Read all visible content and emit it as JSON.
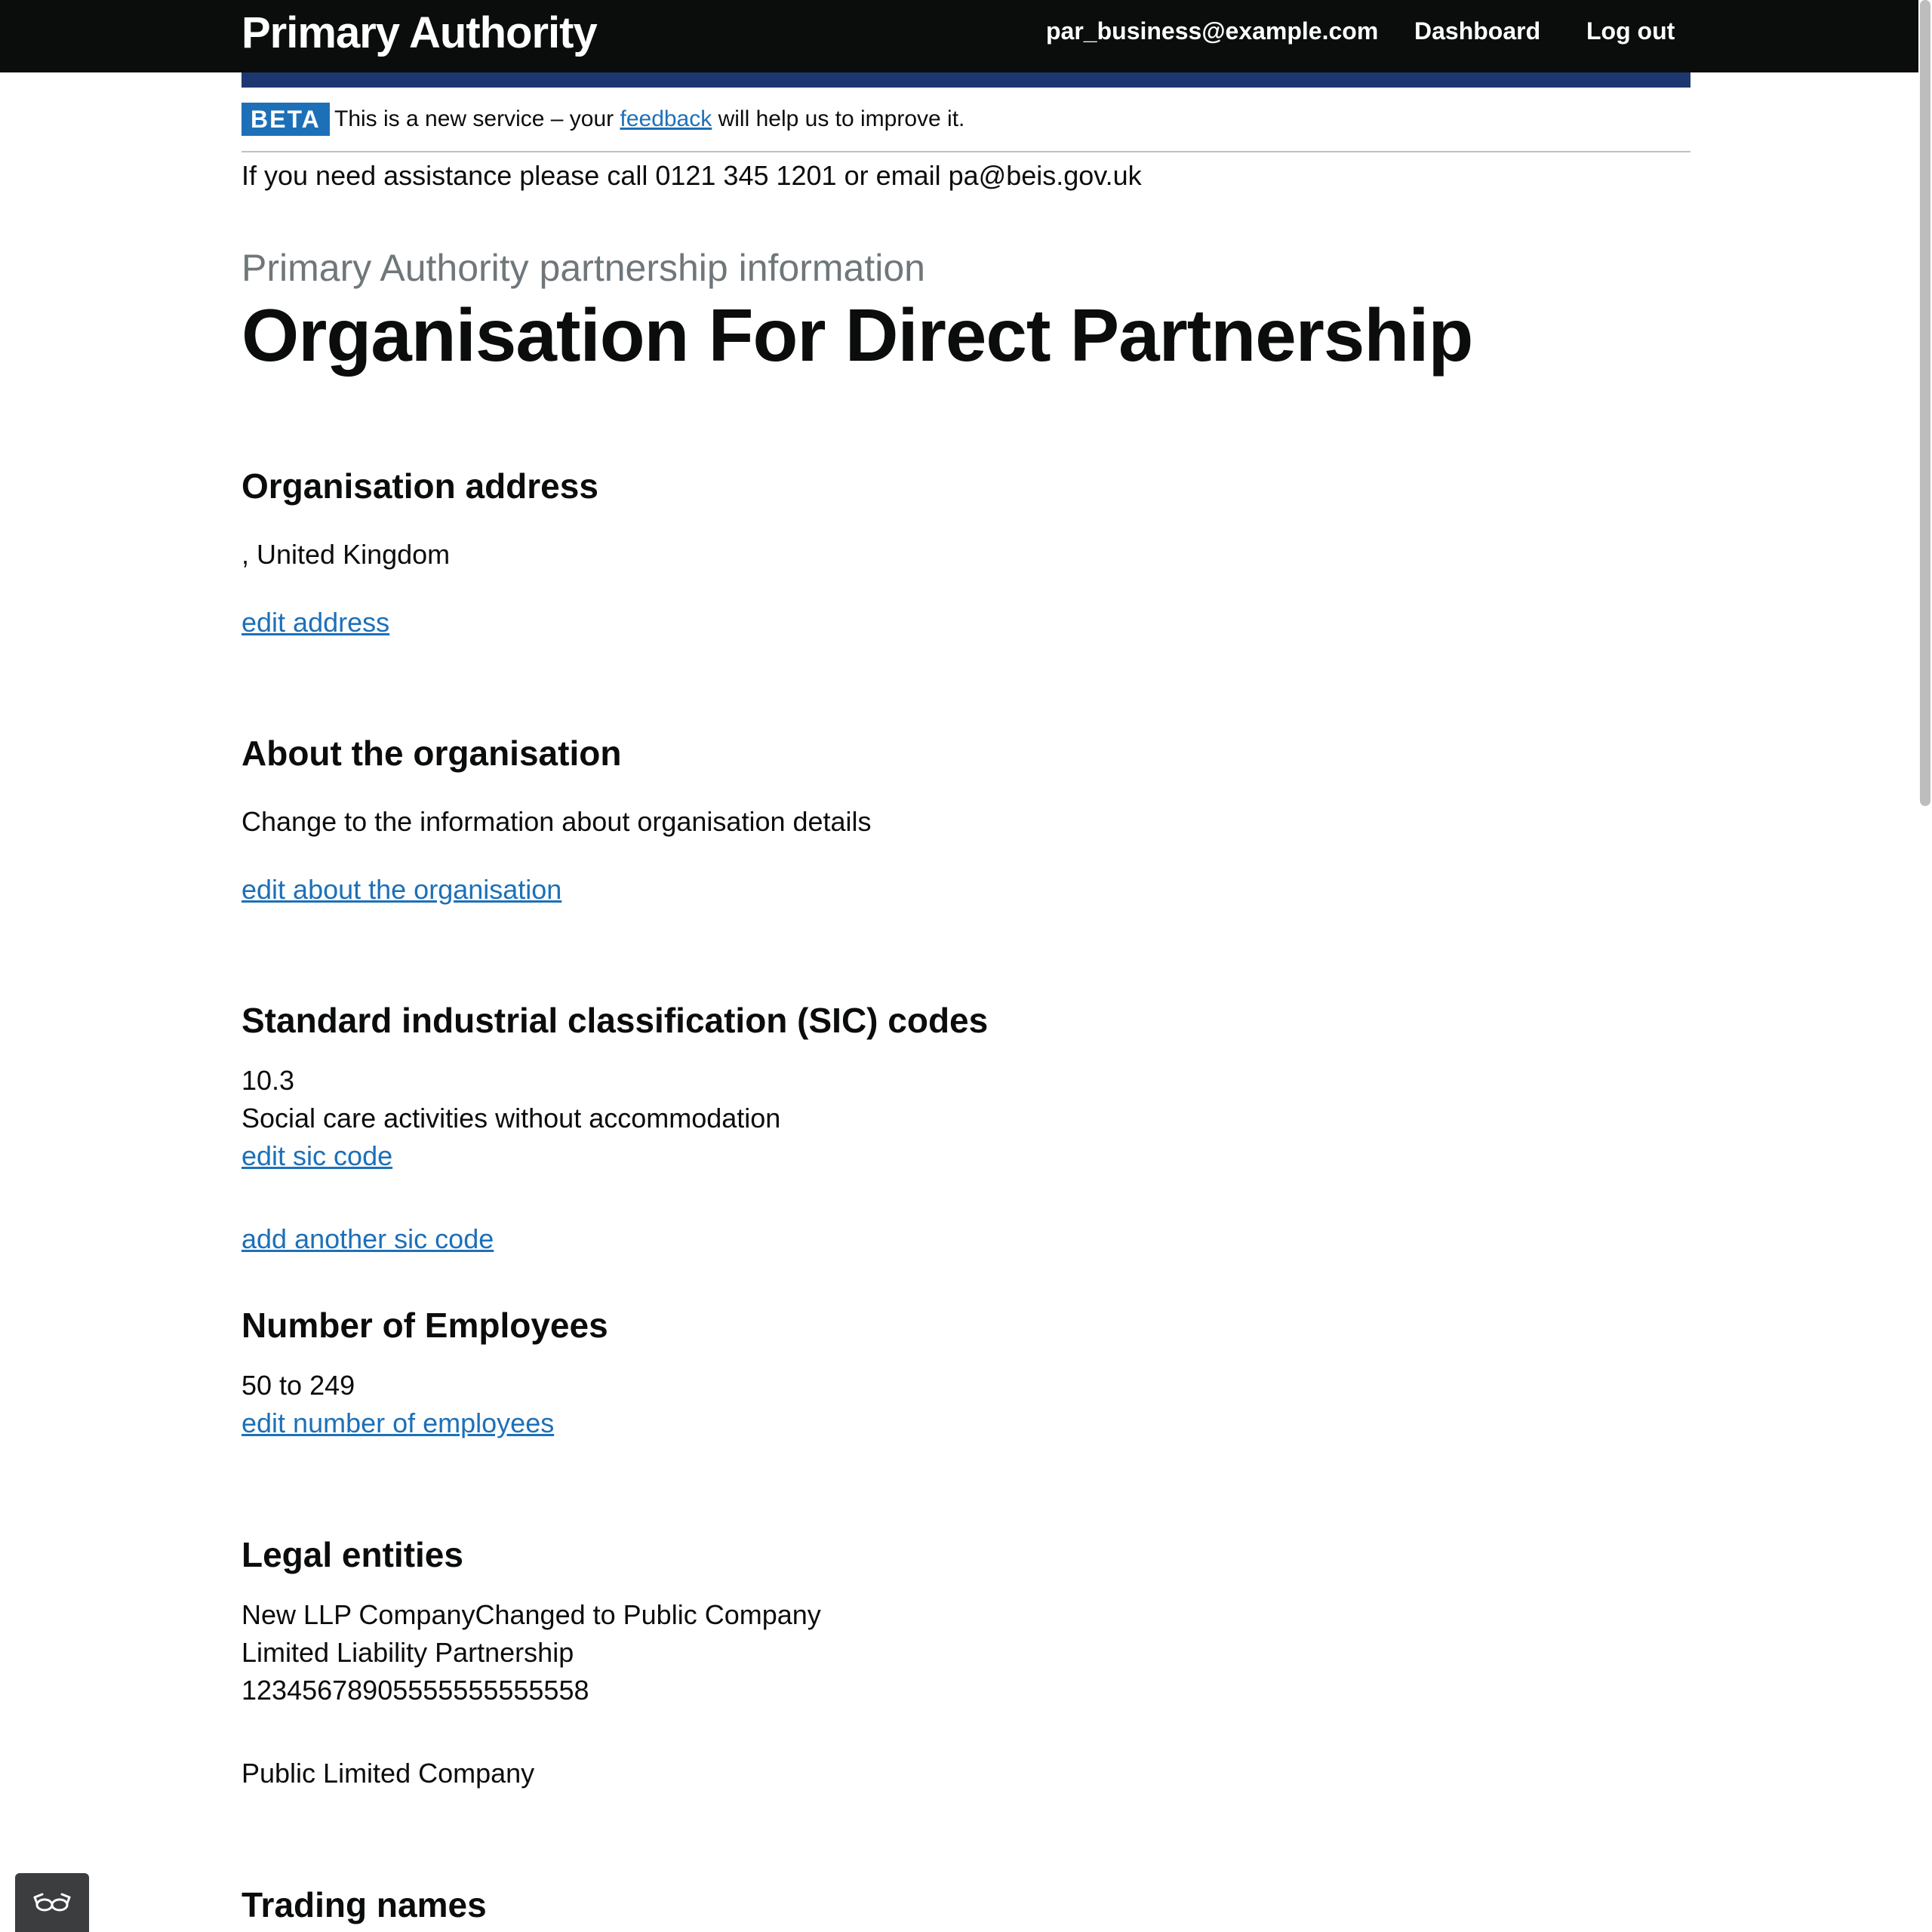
{
  "header": {
    "title": "Primary Authority",
    "nav": {
      "email": "par_business@example.com",
      "dashboard": "Dashboard",
      "logout": "Log out"
    }
  },
  "phase_banner": {
    "tag": "BETA",
    "text_before": "This is a new service – your ",
    "link": "feedback",
    "text_after": " will help us to improve it."
  },
  "assistance": "If you need assistance please call 0121 345 1201 or email pa@beis.gov.uk",
  "page": {
    "caption": "Primary Authority partnership information",
    "title": "Organisation For Direct Partnership"
  },
  "sections": {
    "address": {
      "heading": "Organisation address",
      "value": ", United Kingdom",
      "edit_link": "edit address"
    },
    "about": {
      "heading": "About the organisation",
      "value": "Change to the information about organisation details",
      "edit_link": "edit about the organisation"
    },
    "sic": {
      "heading": "Standard industrial classification (SIC) codes",
      "code": "10.3",
      "description": "Social care activities without accommodation",
      "edit_link": "edit sic code",
      "add_link": "add another sic code"
    },
    "employees": {
      "heading": "Number of Employees",
      "value": "50 to 249",
      "edit_link": "edit number of employees"
    },
    "legal_entities": {
      "heading": "Legal entities",
      "entity1_name": "New LLP CompanyChanged to Public Company",
      "entity1_type": "Limited Liability Partnership",
      "entity1_number": "12345678905555555555558",
      "entity2_type": "Public Limited Company"
    },
    "trading_names": {
      "heading": "Trading names"
    }
  },
  "widgets": {
    "accessibility_icon": "glasses-icon"
  }
}
